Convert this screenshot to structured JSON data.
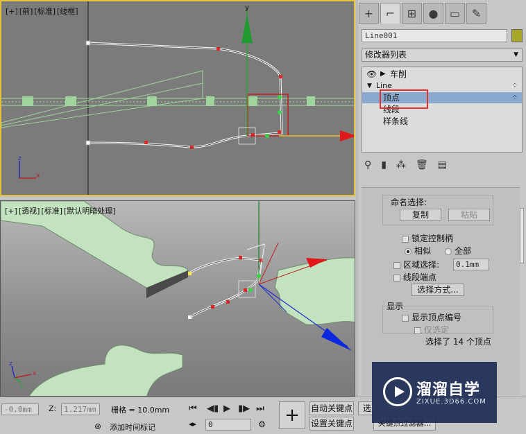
{
  "viewport_top": {
    "label_parts": [
      "[+]",
      "[前]",
      "[标准]",
      "[线框]"
    ],
    "axis_y": "y",
    "axis_x": "x",
    "axis_z": "z"
  },
  "viewport_persp": {
    "label_parts": [
      "[+]",
      "[透视]",
      "[标准]",
      "[默认明暗处理]"
    ],
    "axis_x": "x",
    "axis_y": "y",
    "axis_z": "z"
  },
  "command_panel": {
    "tabs": [
      {
        "icon": "plus-icon",
        "glyph": "+"
      },
      {
        "icon": "modify-icon",
        "glyph": "⌐"
      },
      {
        "icon": "hierarchy-icon",
        "glyph": "⊞"
      },
      {
        "icon": "motion-icon",
        "glyph": "●"
      },
      {
        "icon": "display-icon",
        "glyph": "▭"
      },
      {
        "icon": "utilities-icon",
        "glyph": "✎"
      }
    ],
    "object_name": "Line001",
    "object_color": "#a7a82a",
    "modifier_list": "修改器列表",
    "stack": {
      "lathe": "车削",
      "line": "Line",
      "vertex": "顶点",
      "segment": "线段",
      "spline": "样条线"
    },
    "rollout": {
      "named_selection": "命名选择:",
      "copy": "复制",
      "paste": "粘贴",
      "lock_handles": "锁定控制柄",
      "alike": "相似",
      "all": "全部",
      "area_selection": "区域选择:",
      "area_value": "0.1mm",
      "segment_end": "线段端点",
      "select_by": "选择方式...",
      "display": "显示",
      "show_vertex_numbers": "显示顶点编号",
      "selected_only": "仅选定",
      "status": "选择了 14 个顶点"
    }
  },
  "bottom_bar": {
    "x_value": "-0.0mm",
    "z_label": "Z:",
    "z_value": "1.217mm",
    "grid_label": "栅格 = 10.0mm",
    "add_time_tag": "添加时间标记",
    "auto_key": "自动关键点",
    "set_key": "设置关键点",
    "selected": "选",
    "key_filters": "关键点过滤器...",
    "frame": "0"
  },
  "watermark": {
    "title": "溜溜自学",
    "url": "ZIXUE.3D66.COM"
  },
  "colors": {
    "viewport_active_border": "#e6c23a",
    "selection_box": "#e03030",
    "stack_selection": "#8aa9cf",
    "vertex_red": "#d42a2a"
  }
}
